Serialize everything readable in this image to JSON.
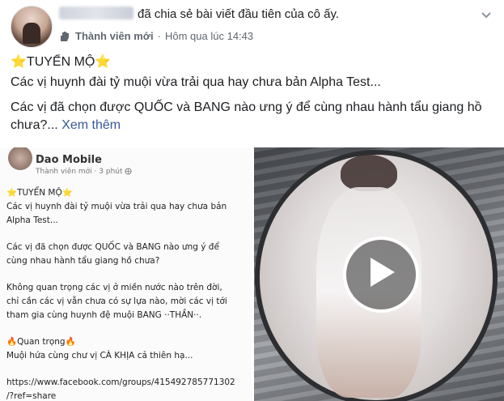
{
  "post": {
    "shared_text": "đã chia sẻ bài viết đầu tiên của cô ấy.",
    "badge_label": "Thành viên mới",
    "separator": "·",
    "timestamp": "Hôm qua lúc 14:43",
    "line1": "⭐TUYỂN MỘ⭐",
    "line2": "Các vị huynh đài tỷ muội vừa trải qua hay chưa bản Alpha Test...",
    "line3": "Các vị đã chọn được QUỐC và BANG nào ưng ý để cùng nhau hành tẩu giang hồ chưa?...",
    "see_more": "Xem thêm"
  },
  "inner_post": {
    "header_name": "Dao Mobile",
    "meta_badge": "Thành viên mới",
    "meta_time": "3 phút",
    "lines": [
      "⭐TUYỂN MỘ⭐",
      "Các vị huynh đài tỷ muội vừa trải qua hay chưa bản",
      "Alpha Test...",
      "",
      "Các vị đã chọn được QUỐC và BANG nào ưng ý để",
      "cùng nhau hành tẩu giang hồ chưa?",
      "",
      "Không quan trọng các vị ở miền nước nào trên đời,",
      "chỉ cần các vị vẫn chưa có sự lựa nào, mời các vị tới",
      "tham gia cùng huynh đệ muội BANG ··THẦN··.",
      "",
      "🔥Quan trọng🔥",
      "Muội hứa cùng chư vị CÀ KHỊA cả thiên hạ...",
      "",
      "https://www.facebook.com/groups/415492785771302",
      "/?ref=share"
    ]
  },
  "icons": {
    "badge": "new-member-hand-icon",
    "chevron": "chevron-down-icon",
    "play": "play-icon",
    "globe": "globe-icon"
  },
  "colors": {
    "link": "#385898",
    "meta": "#606770",
    "text": "#1c1e21"
  }
}
